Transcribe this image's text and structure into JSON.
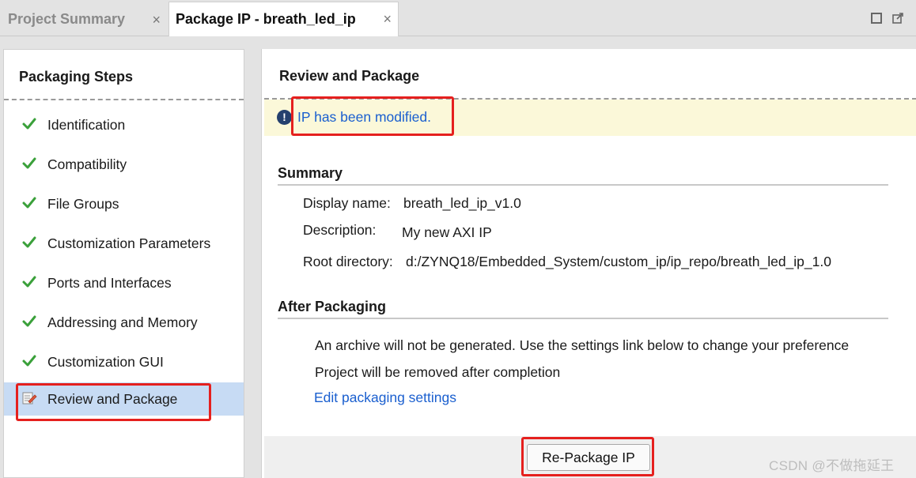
{
  "tabs": [
    {
      "label": "Project Summary",
      "active": false
    },
    {
      "label": "Package IP - breath_led_ip",
      "active": true
    }
  ],
  "tab_close_glyph": "×",
  "sidebar": {
    "title": "Packaging Steps",
    "steps": [
      {
        "label": "Identification",
        "icon": "check-icon",
        "selected": false
      },
      {
        "label": "Compatibility",
        "icon": "check-icon",
        "selected": false
      },
      {
        "label": "File Groups",
        "icon": "check-icon",
        "selected": false
      },
      {
        "label": "Customization Parameters",
        "icon": "check-icon",
        "selected": false
      },
      {
        "label": "Ports and Interfaces",
        "icon": "check-icon",
        "selected": false
      },
      {
        "label": "Addressing and Memory",
        "icon": "check-icon",
        "selected": false
      },
      {
        "label": "Customization GUI",
        "icon": "check-icon",
        "selected": false
      },
      {
        "label": "Review and Package",
        "icon": "edit-document-icon",
        "selected": true
      }
    ]
  },
  "main": {
    "title": "Review and Package",
    "banner": {
      "icon": "info-icon",
      "glyph": "!",
      "message": "IP has been modified."
    },
    "summary": {
      "heading": "Summary",
      "display_name_label": "Display name:",
      "display_name_value": "breath_led_ip_v1.0",
      "description_label": "Description:",
      "description_value": "My new AXI IP",
      "root_label": "Root directory:",
      "root_value": "d:/ZYNQ18/Embedded_System/custom_ip/ip_repo/breath_led_ip_1.0"
    },
    "after": {
      "heading": "After Packaging",
      "line1": "An archive will not be generated. Use the settings link below to change your preference",
      "line2": "Project will be removed after completion",
      "link": "Edit packaging settings"
    },
    "repackage_button": "Re-Package IP"
  },
  "watermark": "CSDN @不做拖延王",
  "colors": {
    "check": "#3aa03a",
    "link": "#1a5fcf",
    "banner_bg": "#fbf8d9",
    "selection": "#c7dbf4",
    "highlight": "#e5201e"
  }
}
